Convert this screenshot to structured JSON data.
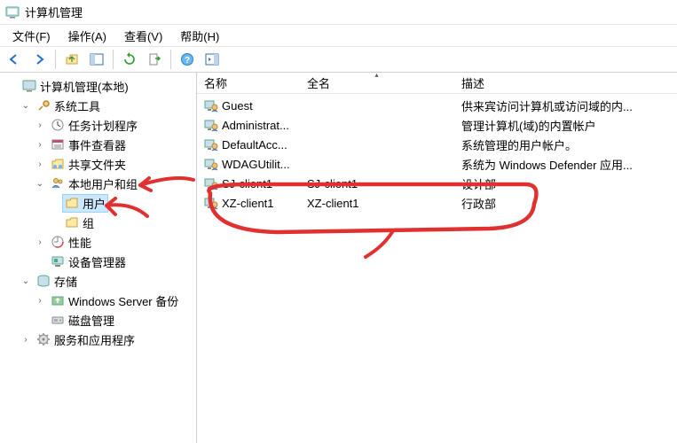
{
  "window": {
    "title": "计算机管理"
  },
  "menu": {
    "file": "文件(F)",
    "action": "操作(A)",
    "view": "查看(V)",
    "help": "帮助(H)"
  },
  "tree": {
    "root": "计算机管理(本地)",
    "system_tools": "系统工具",
    "task_scheduler": "任务计划程序",
    "event_viewer": "事件查看器",
    "shared_folders": "共享文件夹",
    "local_users_groups": "本地用户和组",
    "users": "用户",
    "groups": "组",
    "performance": "性能",
    "device_manager": "设备管理器",
    "storage": "存储",
    "wsb": "Windows Server 备份",
    "disk_mgmt": "磁盘管理",
    "services_apps": "服务和应用程序"
  },
  "columns": {
    "name": "名称",
    "fullname": "全名",
    "description": "描述"
  },
  "rows": [
    {
      "name": "Guest",
      "fullname": "",
      "description": "供来宾访问计算机或访问域的内..."
    },
    {
      "name": "Administrat...",
      "fullname": "",
      "description": "管理计算机(域)的内置帐户"
    },
    {
      "name": "DefaultAcc...",
      "fullname": "",
      "description": "系统管理的用户帐户。"
    },
    {
      "name": "WDAGUtilit...",
      "fullname": "",
      "description": "系统为 Windows Defender 应用..."
    },
    {
      "name": "SJ-client1",
      "fullname": "SJ-client1",
      "description": "设计部"
    },
    {
      "name": "XZ-client1",
      "fullname": "XZ-client1",
      "description": "行政部"
    }
  ]
}
